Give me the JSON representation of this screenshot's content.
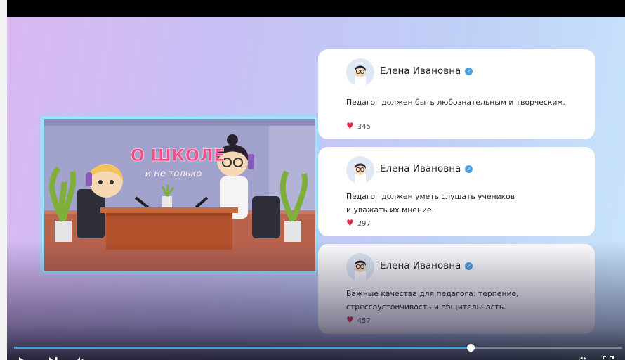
{
  "thumbnail": {
    "title_line1": "О ШКОЛЕ",
    "title_line2": "и не только"
  },
  "comments": [
    {
      "author": "Елена Ивановна",
      "text": "Педагог  должен быть любознательным и творческим.",
      "likes": "345"
    },
    {
      "author": "Елена Ивановна",
      "text_line1": "Педагог должен уметь слушать учеников",
      "text_line2": "и уважать их мнение.",
      "likes": "297"
    },
    {
      "author": "Елена Ивановна",
      "text_line1": "Важные качества для педагога: терпение,",
      "text_line2": "стрессоустойчивость и общительность.",
      "likes": "457"
    }
  ],
  "player": {
    "progress": 0.75,
    "accent_color": "#3aa3e3",
    "icons": [
      "play-icon",
      "next-icon",
      "volume-icon",
      "settings-icon",
      "fullscreen-icon"
    ]
  }
}
